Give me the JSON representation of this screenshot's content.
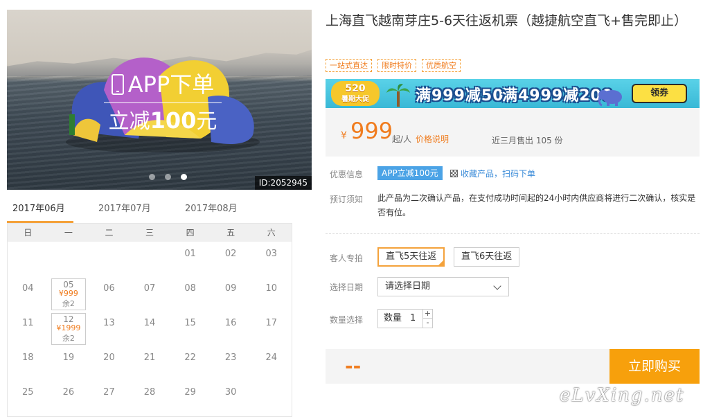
{
  "hero": {
    "app_text": "APP下单",
    "discount_prefix": "立减",
    "discount_amount": "100",
    "discount_suffix": "元",
    "image_id": "ID:2052945"
  },
  "calendar": {
    "months": [
      "2017年06月",
      "2017年07月",
      "2017年08月"
    ],
    "active_month": 0,
    "weekdays": [
      "日",
      "一",
      "二",
      "三",
      "四",
      "五",
      "六"
    ],
    "rows": [
      [
        {
          "d": ""
        },
        {
          "d": ""
        },
        {
          "d": ""
        },
        {
          "d": ""
        },
        {
          "d": "01"
        },
        {
          "d": "02"
        },
        {
          "d": "03"
        }
      ],
      [
        {
          "d": "04"
        },
        {
          "d": "05",
          "price": "¥999",
          "stock": "余2"
        },
        {
          "d": "06"
        },
        {
          "d": "07"
        },
        {
          "d": "08"
        },
        {
          "d": "09"
        },
        {
          "d": "10"
        }
      ],
      [
        {
          "d": "11"
        },
        {
          "d": "12",
          "price": "¥1999",
          "stock": "余2"
        },
        {
          "d": "13"
        },
        {
          "d": "14"
        },
        {
          "d": "15"
        },
        {
          "d": "16"
        },
        {
          "d": "17"
        }
      ],
      [
        {
          "d": "18"
        },
        {
          "d": "19"
        },
        {
          "d": "20"
        },
        {
          "d": "21"
        },
        {
          "d": "22"
        },
        {
          "d": "23"
        },
        {
          "d": "24"
        }
      ],
      [
        {
          "d": "25"
        },
        {
          "d": "26"
        },
        {
          "d": "27"
        },
        {
          "d": "28"
        },
        {
          "d": "29"
        },
        {
          "d": "30"
        },
        {
          "d": ""
        }
      ]
    ]
  },
  "product": {
    "title": "上海直飞越南芽庄5-6天往返机票（越捷航空直飞+售完即止）",
    "tags": [
      "一站式直达",
      "限时特价",
      "优质航空"
    ]
  },
  "banner": {
    "badge_top": "520",
    "badge_bottom": "暑期大促",
    "offer1": "满999减50",
    "offer2": "满4999减200",
    "coupon_button": "领券"
  },
  "price": {
    "currency": "¥",
    "amount": "999",
    "unit": "起/人",
    "explain_link": "价格说明",
    "sold": "近三月售出 105 份"
  },
  "info": {
    "promo_label": "优惠信息",
    "promo_badge": "APP立减100元",
    "qr_link": "收藏产品，扫码下单",
    "notice_label": "预订须知",
    "notice_text": "此产品为二次确认产品，在支付成功时间起的24小时内供应商将进行二次确认，核实是否有位。"
  },
  "options": {
    "label": "客人专拍",
    "items": [
      "直飞5天往返",
      "直飞6天往返"
    ],
    "selected": 0
  },
  "date_select": {
    "label": "选择日期",
    "placeholder": "请选择日期"
  },
  "quantity": {
    "label": "数量选择",
    "prefix": "数量",
    "value": "1",
    "plus": "+",
    "minus": "-"
  },
  "buy": {
    "total": "--",
    "button": "立即购买"
  },
  "watermark": "eLvXing.net",
  "colors": {
    "accent": "#f07c1e",
    "buy_button": "#f7a00c",
    "promo_badge": "#4ba3e6",
    "link": "#3a8bd8"
  }
}
